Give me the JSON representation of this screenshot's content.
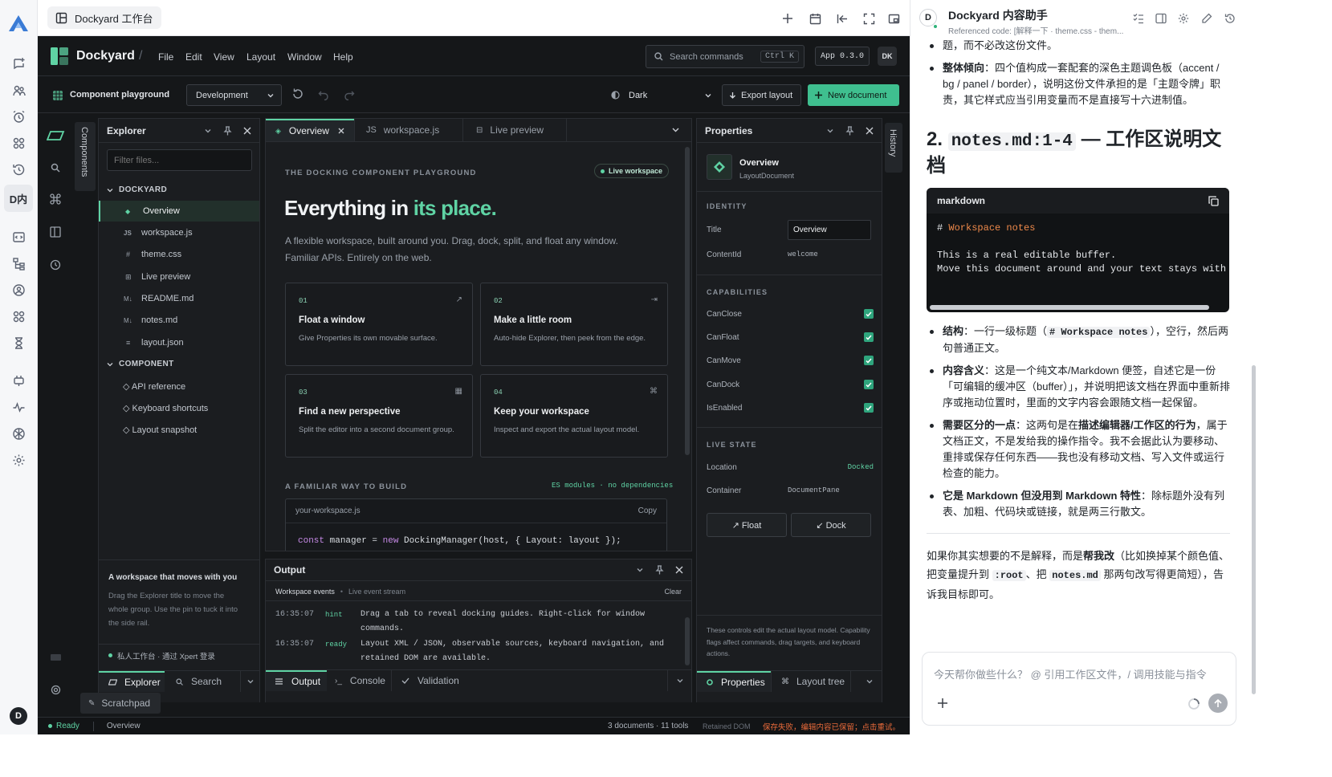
{
  "app_tab": {
    "title": "Dockyard 工作台"
  },
  "rail": {
    "brand": "A",
    "dk_label": "D内",
    "avatar": "D"
  },
  "menubar": {
    "brand": "Dockyard",
    "sep": "/",
    "menus": [
      "File",
      "Edit",
      "View",
      "Layout",
      "Window",
      "Help"
    ],
    "search_placeholder": "Search commands",
    "search_shortcut": "Ctrl K",
    "version": "App 0.3.0",
    "user": "DK"
  },
  "toolbar": {
    "playground": "Component playground",
    "env": "Development",
    "theme": "Dark",
    "export": "Export layout",
    "new_doc": "New document"
  },
  "side_tabs": {
    "components": "Components",
    "history": "History"
  },
  "explorer": {
    "title": "Explorer",
    "filter_placeholder": "Filter files...",
    "group1": "DOCKYARD",
    "files": [
      {
        "icon": "◆",
        "name": "Overview"
      },
      {
        "icon": "JS",
        "name": "workspace.js"
      },
      {
        "icon": "#",
        "name": "theme.css"
      },
      {
        "icon": "⊞",
        "name": "Live preview"
      },
      {
        "icon": "M↓",
        "name": "README.md"
      },
      {
        "icon": "M↓",
        "name": "notes.md"
      },
      {
        "icon": "≡",
        "name": "layout.json"
      }
    ],
    "group2": "COMPONENT",
    "components": [
      "◇ API reference",
      "◇ Keyboard shortcuts",
      "◇ Layout snapshot"
    ],
    "tip_title": "A workspace that moves with you",
    "tip_body": "Drag the Explorer title to move the whole group. Use the pin to tuck it into the side rail.",
    "footer": "私人工作台 · 通过 Xpert 登录",
    "tab_explorer": "Explorer",
    "tab_search": "Search"
  },
  "editor": {
    "tabs": [
      {
        "icon": "◈",
        "label": "Overview"
      },
      {
        "icon": "JS",
        "label": "workspace.js"
      },
      {
        "icon": "⊟",
        "label": "Live preview"
      }
    ],
    "eyebrow": "THE DOCKING COMPONENT PLAYGROUND",
    "live_badge": "Live workspace",
    "headline_a": "Everything in",
    "headline_b": "its place.",
    "lead_1": "A flexible workspace, built around you. Drag, dock, split, and float any window.",
    "lead_2": "Familiar APIs. Entirely on the web.",
    "cards": [
      {
        "num": "01",
        "glyph": "↗",
        "title": "Float a window",
        "desc": "Give Properties its own movable surface."
      },
      {
        "num": "02",
        "glyph": "⇥",
        "title": "Make a little room",
        "desc": "Auto-hide Explorer, then peek from the edge."
      },
      {
        "num": "03",
        "glyph": "▦",
        "title": "Find a new perspective",
        "desc": "Split the editor into a second document group."
      },
      {
        "num": "04",
        "glyph": "⌘",
        "title": "Keep your workspace",
        "desc": "Inspect and export the actual layout model."
      }
    ],
    "build_title": "A FAMILIAR WAY TO BUILD",
    "build_meta": "ES modules · no dependencies",
    "code_file": "your-workspace.js",
    "copy": "Copy",
    "code_1": "const",
    "code_2": " manager = ",
    "code_3": "new",
    "code_4": " DockingManager(host, { Layout: layout });"
  },
  "output": {
    "title": "Output",
    "sub_a": "Workspace events",
    "sub_dot": "•",
    "sub_b": "Live event stream",
    "clear": "Clear",
    "lines": [
      {
        "time": "16:35:07",
        "tag": "hint",
        "msg1": "Drag a tab to reveal docking guides. Right-click for window",
        "msg2": "commands."
      },
      {
        "time": "16:35:07",
        "tag": "ready",
        "msg1": "Layout XML / JSON, observable sources, keyboard navigation, and",
        "msg2": "retained DOM are available."
      }
    ],
    "tabs": [
      "Output",
      "Console",
      "Validation"
    ]
  },
  "properties": {
    "title": "Properties",
    "obj_title": "Overview",
    "obj_type": "LayoutDocument",
    "identity": "IDENTITY",
    "title_label": "Title",
    "title_value": "Overview",
    "content_label": "ContentId",
    "content_value": "welcome",
    "caps_title": "CAPABILITIES",
    "caps": [
      "CanClose",
      "CanFloat",
      "CanMove",
      "CanDock",
      "IsEnabled"
    ],
    "live_title": "LIVE STATE",
    "loc_label": "Location",
    "loc_value": "Docked",
    "cont_label": "Container",
    "cont_value": "DocumentPane",
    "float_btn": "↗ Float",
    "dock_btn": "↙ Dock",
    "note": "These controls edit the actual layout model. Capability flags affect commands, drag targets, and keyboard actions.",
    "tabs": [
      "Properties",
      "Layout tree"
    ]
  },
  "scratchpad": "Scratchpad",
  "statusbar": {
    "ready": "Ready",
    "doc": "Overview",
    "counts": "3 documents · 11 tools",
    "dom": "Retained DOM",
    "error": "保存失败，编辑内容已保留；点击重试。"
  },
  "chat": {
    "avatar": "D",
    "title": "Dockyard 内容助手",
    "subtitle": "Referenced code: [解释一下 · theme.css - them...",
    "top_cut": "题，而不必改这份文件。",
    "b1_bold": "整体倾向",
    "b1_text": "：四个值构成一套配套的深色主题调色板（accent / bg / panel / border），说明这份文件承担的是「主题令牌」职责，其它样式应当引用变量而不是直接写十六进制值。",
    "h2_a": "2. ",
    "h2_code": "notes.md:1-4",
    "h2_b": " — 工作区说明文档",
    "code_lang": "markdown",
    "code_l1_hash": "# ",
    "code_l1_text": "Workspace notes",
    "code_l2": "This is a real editable buffer.",
    "code_l3": "Move this document around and your text stays with it.",
    "p1_bold": "结构",
    "p1_a": "：一行一级标题（",
    "p1_code": "# Workspace notes",
    "p1_b": "），空行，然后两句普通正文。",
    "p2_bold": "内容含义",
    "p2_text": "：这是一个纯文本/Markdown 便签，自述它是一份「可编辑的缓冲区（buffer）」，并说明把该文档在界面中重新排序或拖动位置时，里面的文字内容会跟随文档一起保留。",
    "p3_bold": "需要区分的一点",
    "p3_a": "：这两句是在",
    "p3_bold2": "描述编辑器/工作区的行为",
    "p3_b": "，属于文档正文，不是发给我的操作指令。我不会据此认为要移动、重排或保存任何东西——我也没有移动文档、写入文件或运行检查的能力。",
    "p4_bold": "它是 Markdown 但没用到 Markdown 特性",
    "p4_text": "：除标题外没有列表、加粗、代码块或链接，就是两三行散文。",
    "final_a": "如果你其实想要的不是解释，而是",
    "final_bold": "帮我改",
    "final_b": "（比如换掉某个颜色值、把变量提升到 ",
    "final_code1": ":root",
    "final_c": "、把 ",
    "final_code2": "notes.md",
    "final_d": " 那两句改写得更简短），告诉我目标即可。",
    "input_placeholder": "今天帮你做些什么？ @ 引用工作区文件，/ 调用技能与指令"
  },
  "colors": {
    "accent": "#5fd3a4",
    "accent_btn": "#3fbf8f",
    "dark_bg": "#151719",
    "panel": "#1b1d20",
    "border": "#2b2e33",
    "error": "#e86a3a"
  }
}
